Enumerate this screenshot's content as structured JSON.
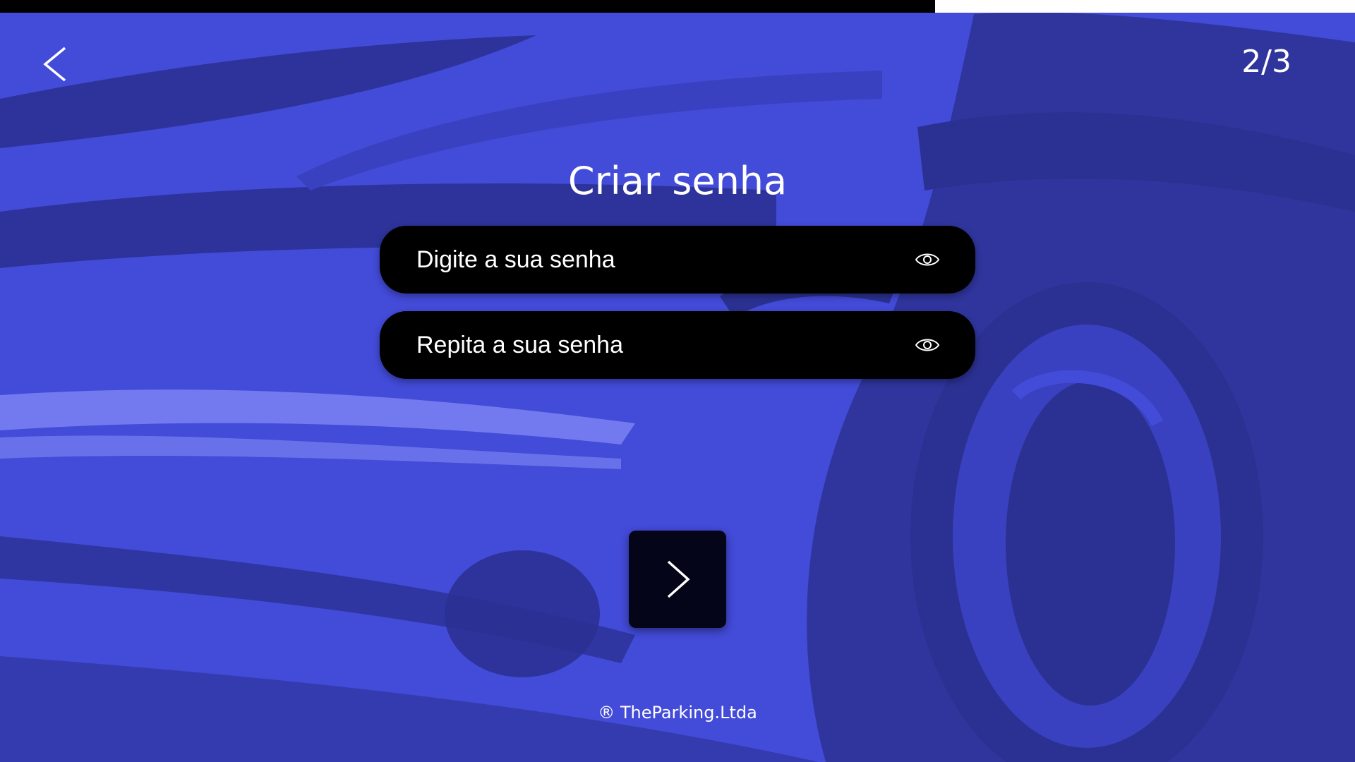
{
  "progress": {
    "value": 0.69,
    "fill_color": "#000000",
    "track_color": "#ffffff"
  },
  "nav": {
    "back_icon": "chevron-left-icon",
    "step_counter": "2/3"
  },
  "title": "Criar senha",
  "fields": [
    {
      "placeholder": "Digite a sua senha",
      "icon": "eye-icon"
    },
    {
      "placeholder": "Repita a sua senha",
      "icon": "eye-icon"
    }
  ],
  "next_button": {
    "icon": "chevron-right-icon"
  },
  "footer": {
    "copyright": "® TheParking.Ltda"
  },
  "colors": {
    "background": "#434bd9",
    "background_shadow": "#2b3192",
    "field_background": "#000000",
    "button_background": "#05051a",
    "text": "#ffffff"
  }
}
